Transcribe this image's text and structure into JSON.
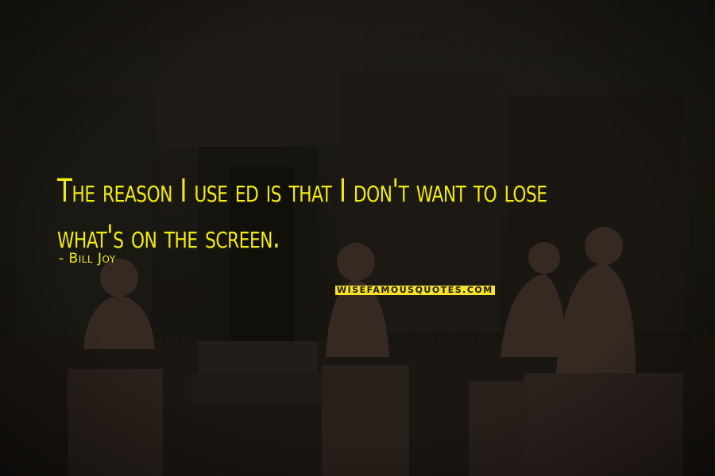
{
  "poster": {
    "quote": "The reason I use ed is that I don't want to lose what's on the screen.",
    "author": "- Bill Joy",
    "watermark": "WISEFAMOUSQUOTES.COM",
    "colors": {
      "text": "#f2ec0f",
      "watermark_bg": "#f5e02a",
      "background": "#1c1a14"
    }
  }
}
